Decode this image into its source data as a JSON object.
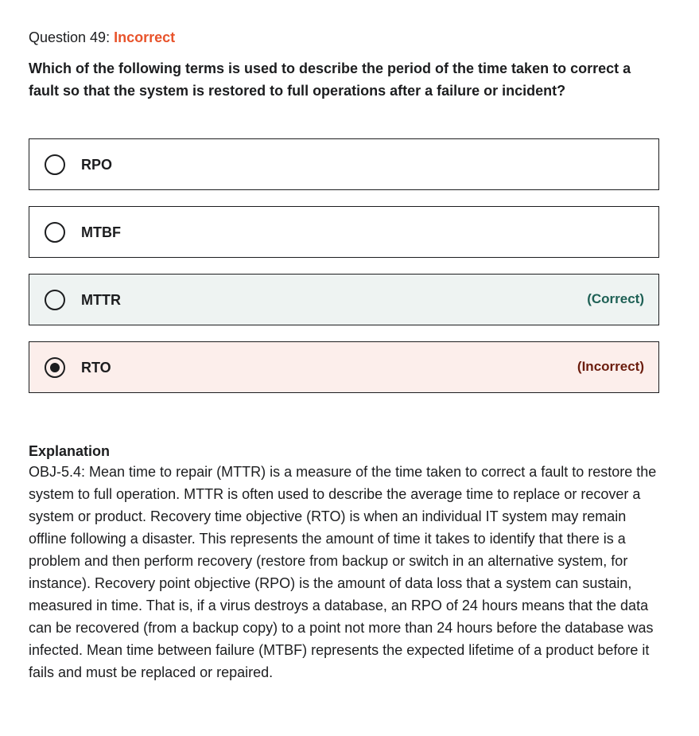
{
  "question": {
    "header_prefix": "Question 49: ",
    "status": "Incorrect",
    "text": "Which of the following terms is used to describe the period of the time taken to correct a fault so that the system is restored to full operations after a failure or incident?"
  },
  "options": [
    {
      "label": "RPO",
      "selected": false,
      "tag": ""
    },
    {
      "label": "MTBF",
      "selected": false,
      "tag": ""
    },
    {
      "label": "MTTR",
      "selected": false,
      "tag": "(Correct)"
    },
    {
      "label": "RTO",
      "selected": true,
      "tag": "(Incorrect)"
    }
  ],
  "explanation": {
    "title": "Explanation",
    "body": "OBJ-5.4: Mean time to repair (MTTR) is a measure of the time taken to correct a fault to restore the system to full operation. MTTR is often used to describe the average time to replace or recover a system or product. Recovery time objective (RTO) is when an individual IT system may remain offline following a disaster. This represents the amount of time it takes to identify that there is a problem and then perform recovery (restore from backup or switch in an alternative system, for instance). Recovery point objective (RPO) is the amount of data loss that a system can sustain, measured in time. That is, if a virus destroys a database, an RPO of 24 hours means that the data can be recovered (from a backup copy) to a point not more than 24 hours before the database was infected. Mean time between failure (MTBF) represents the expected lifetime of a product before it fails and must be replaced or repaired."
  },
  "colors": {
    "status_incorrect": "#e8532b",
    "correct_bg": "#eef3f2",
    "incorrect_bg": "#fceeeb",
    "correct_text": "#1e6055",
    "incorrect_text": "#6b1d0e"
  }
}
